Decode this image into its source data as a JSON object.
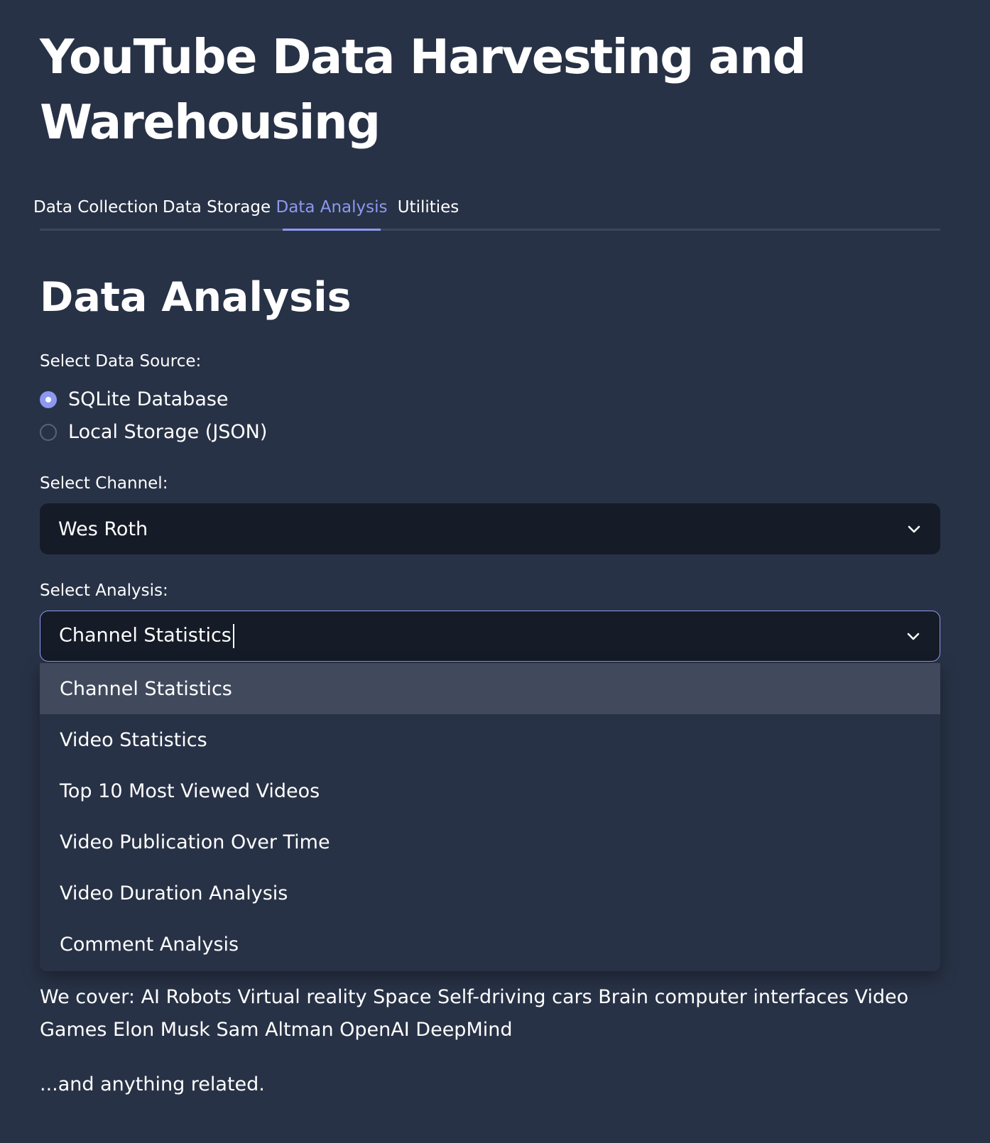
{
  "app": {
    "title": "YouTube Data Harvesting and Warehousing"
  },
  "tabs": [
    {
      "label": "Data Collection",
      "active": false
    },
    {
      "label": "Data Storage",
      "active": false
    },
    {
      "label": "Data Analysis",
      "active": true
    },
    {
      "label": "Utilities",
      "active": false
    }
  ],
  "analysis": {
    "heading": "Data Analysis",
    "data_source": {
      "label": "Select Data Source:",
      "options": [
        {
          "label": "SQLite Database",
          "selected": true
        },
        {
          "label": "Local Storage (JSON)",
          "selected": false
        }
      ]
    },
    "channel": {
      "label": "Select Channel:",
      "value": "Wes Roth"
    },
    "analysis_select": {
      "label": "Select Analysis:",
      "value": "Channel Statistics",
      "options": [
        "Channel Statistics",
        "Video Statistics",
        "Top 10 Most Viewed Videos",
        "Video Publication Over Time",
        "Video Duration Analysis",
        "Comment Analysis"
      ]
    },
    "description": {
      "line1": "We cover: AI Robots Virtual reality Space Self-driving cars Brain computer interfaces Video Games Elon Musk Sam Altman OpenAI DeepMind",
      "line2": "...and anything related."
    }
  },
  "colors": {
    "background": "#283246",
    "accent": "#8d98f0",
    "input_bg": "#151b27",
    "option_highlight": "#414a5d",
    "tab_divider": "#3d4658"
  },
  "icons": {
    "select_chevron": "chevron-down-icon"
  }
}
